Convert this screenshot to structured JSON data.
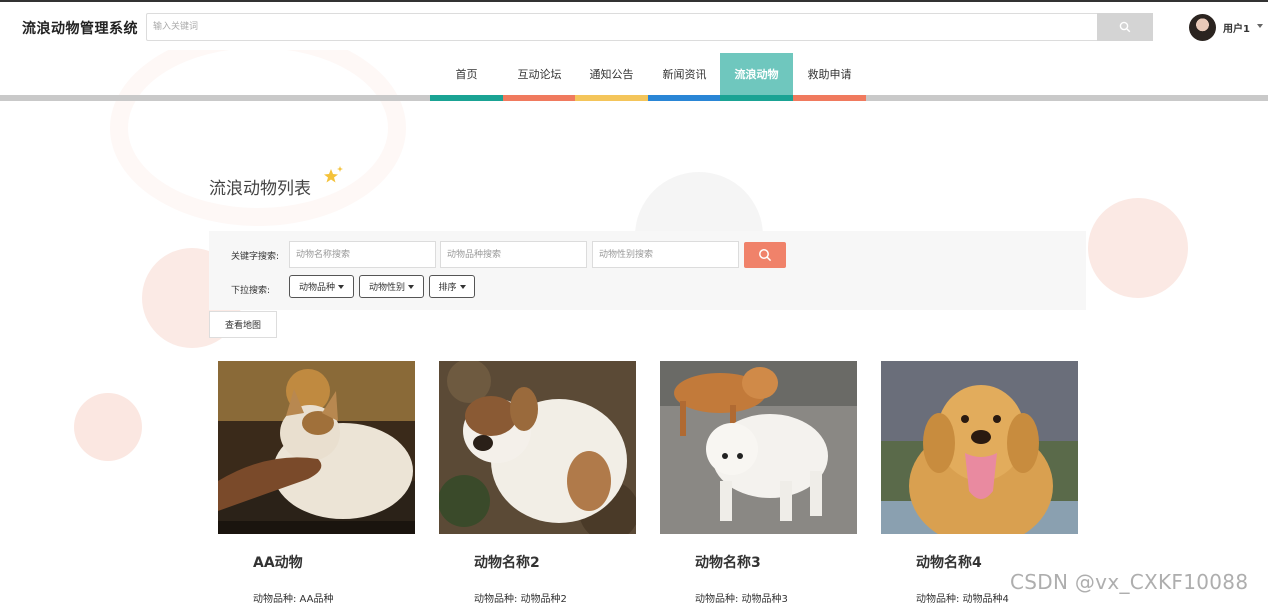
{
  "header": {
    "brand": "流浪动物管理系统",
    "search_placeholder": "输入关键词",
    "user_name": "用户1"
  },
  "nav": {
    "items": [
      {
        "label": "首页",
        "color": "#1aa394"
      },
      {
        "label": "互动论坛",
        "color": "#f07a5e"
      },
      {
        "label": "通知公告",
        "color": "#f4c55a"
      },
      {
        "label": "新闻资讯",
        "color": "#2a86d6"
      },
      {
        "label": "流浪动物",
        "color": "#1aa394",
        "active": true
      },
      {
        "label": "救助申请",
        "color": "#f07a5e"
      }
    ]
  },
  "main": {
    "title": "流浪动物列表",
    "search": {
      "keyword_label": "关键字搜索:",
      "name_placeholder": "动物名称搜索",
      "breed_placeholder": "动物品种搜索",
      "gender_placeholder": "动物性别搜索",
      "dropdown_label": "下拉搜索:",
      "dropdowns": [
        "动物品种",
        "动物性别",
        "排序"
      ]
    },
    "map_button": "查看地图",
    "cards": [
      {
        "name": "AA动物",
        "breed": "动物品种: AA品种",
        "image": "cat-being-petted"
      },
      {
        "name": "动物名称2",
        "breed": "动物品种: 动物品种2",
        "image": "puppy-on-leaves"
      },
      {
        "name": "动物名称3",
        "breed": "动物品种: 动物品种3",
        "image": "white-dog-walking"
      },
      {
        "name": "动物名称4",
        "breed": "动物品种: 动物品种4",
        "image": "golden-retriever"
      }
    ]
  },
  "watermark": "CSDN @vx_CXKF10088",
  "colors": {
    "accent": "#f0826a",
    "active_nav": "#6fc7be"
  }
}
